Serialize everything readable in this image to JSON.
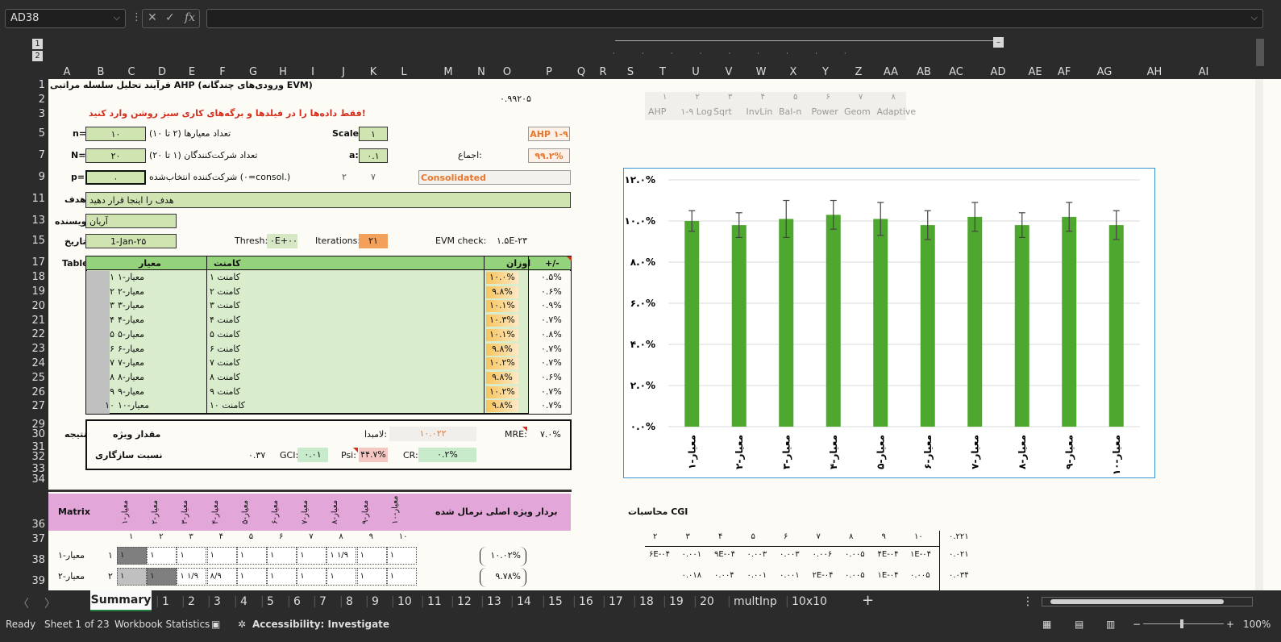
{
  "namebox": "AD38",
  "formula_bar": {
    "value": ""
  },
  "col_headers": [
    "A",
    "B",
    "C",
    "D",
    "E",
    "F",
    "G",
    "H",
    "I",
    "J",
    "K",
    "L",
    "M",
    "N",
    "O",
    "P",
    "Q",
    "R",
    "S",
    "T",
    "U",
    "V",
    "W",
    "X",
    "Y",
    "Z",
    "AA",
    "AB",
    "AC",
    "AD",
    "AE",
    "AF",
    "AG",
    "AH",
    "AI"
  ],
  "row_headers": [
    "1",
    "2",
    "3",
    "5",
    "7",
    "9",
    "11",
    "13",
    "15",
    "17",
    "18",
    "19",
    "20",
    "21",
    "22",
    "23",
    "24",
    "25",
    "26",
    "27",
    "29",
    "30",
    "31",
    "32",
    "33",
    "34",
    "36",
    "37",
    "38",
    "39"
  ],
  "outline_levels": [
    "1",
    "2"
  ],
  "sheet": {
    "title": "فرآیند تحلیل سلسله مراتبی AHP (ورودی‌های چندگانه EVM)",
    "top_value": "۰.۹۹۲۰۵",
    "instruction": "فقط داده‌ها را در فیلدها و برگه‌های کاری سبز روشن وارد کنید!",
    "n_label": "n=",
    "n_value": "۱۰",
    "n_desc": "تعداد معیارها (۲ تا ۱۰)",
    "scale_label": "Scale:",
    "scale_value": "۱",
    "scale_name": "AHP ۱-۹",
    "N_label": "N=",
    "N_value": "۲۰",
    "N_desc": "تعداد شرکت‌کنندگان (۱ تا ۲۰)",
    "a_label": "a:",
    "a_value": "۰.۱",
    "consensus_label": "اجماع:",
    "consensus_value": "۹۹.۲%",
    "p_label": "p=",
    "p_value": "۰",
    "p_desc": "شرکت‌کننده انتخاب‌شده (۰=consol.)",
    "p_num1": "۲",
    "p_num2": "۷",
    "consolidated": "Consolidated",
    "goal_label": "هدف",
    "goal_value": "هدف را اینجا قرار دهید",
    "author_label": "نویسنده",
    "author_value": "آریان",
    "date_label": "تاریخ",
    "date_value": "1-Jan-۲۵",
    "thresh_label": "Thresh:",
    "thresh_value": "۰E+۰۰",
    "iter_label": "Iterations:",
    "iter_value": "۲۱",
    "evm_label": "EVM check:",
    "evm_value": "۱.۵E-۲۳",
    "table_label": "Table",
    "col_criteria": "معیار",
    "col_comment": "کامنت",
    "col_weights": "اوزان",
    "col_pm": "+/-",
    "rows": [
      {
        "n": "۱",
        "c": "معیار-۱",
        "k": "کامنت ۱",
        "w": "۱۰.۰%",
        "p": "۰.۵%"
      },
      {
        "n": "۲",
        "c": "معیار-۲",
        "k": "کامنت ۲",
        "w": "۹.۸%",
        "p": "۰.۶%"
      },
      {
        "n": "۳",
        "c": "معیار-۳",
        "k": "کامنت ۳",
        "w": "۱۰.۱%",
        "p": "۰.۹%"
      },
      {
        "n": "۴",
        "c": "معیار-۴",
        "k": "کامنت ۴",
        "w": "۱۰.۳%",
        "p": "۰.۷%"
      },
      {
        "n": "۵",
        "c": "معیار-۵",
        "k": "کامنت ۵",
        "w": "۱۰.۱%",
        "p": "۰.۸%"
      },
      {
        "n": "۶",
        "c": "معیار-۶",
        "k": "کامنت ۶",
        "w": "۹.۸%",
        "p": "۰.۷%"
      },
      {
        "n": "۷",
        "c": "معیار-۷",
        "k": "کامنت ۷",
        "w": "۱۰.۲%",
        "p": "۰.۷%"
      },
      {
        "n": "۸",
        "c": "معیار-۸",
        "k": "کامنت ۸",
        "w": "۹.۸%",
        "p": "۰.۶%"
      },
      {
        "n": "۹",
        "c": "معیار-۹",
        "k": "کامنت ۹",
        "w": "۱۰.۲%",
        "p": "۰.۷%"
      },
      {
        "n": "۱۰",
        "c": "معیار-۱۰",
        "k": "کامنت ۱۰",
        "w": "۹.۸%",
        "p": "۰.۷%"
      }
    ],
    "result_label": "نتیجه",
    "eigen_label": "مقدار ویژه",
    "lambda_label": "لامبدا:",
    "lambda_value": "۱۰.۰۲۲",
    "mre_label": "MRE:",
    "mre_value": "۷.۰%",
    "consist_label": "نسبت سازگاری",
    "gci_pre": "۰.۳۷",
    "gci_label": "GCI:",
    "gci_value": "۰.۰۱",
    "psi_label": "Psi:",
    "psi_value": "۴۴.۷%",
    "cr_label": "CR:",
    "cr_value": "۰.۲%",
    "matrix_label": "Matrix",
    "evec_label": "بردار ویژه اصلی نرمال شده",
    "matrix_headers": [
      "معیار-۱",
      "معیار-۲",
      "معیار-۳",
      "معیار-۴",
      "معیار-۵",
      "معیار-۶",
      "معیار-۷",
      "معیار-۸",
      "معیار-۹",
      "معیار-۱۰"
    ],
    "matrix_nums": [
      "۱",
      "۲",
      "۳",
      "۴",
      "۵",
      "۶",
      "۷",
      "۸",
      "۹",
      "۱۰"
    ],
    "matrix_rows": [
      {
        "label": "معیار-۱",
        "n": "۱",
        "cells": [
          "۱",
          "۱",
          "۱",
          "۱",
          "۱",
          "۱",
          "۱",
          "۱ ۱/۹",
          "۱",
          "۱"
        ],
        "ev": "۱۰.۰۲%"
      },
      {
        "label": "معیار-۲",
        "n": "۲",
        "cells": [
          "۱",
          "۱",
          "۱ ۱/۹",
          "۸/۹",
          "۱",
          "۱",
          "۱",
          "۱",
          "۱",
          "۱"
        ],
        "ev": "۹.۷۸%"
      }
    ],
    "scale_options": {
      "nums": [
        "۱",
        "۲",
        "۳",
        "۴",
        "۵",
        "۶",
        "۷",
        "۸"
      ],
      "names": [
        "AHP",
        "۱-۹ Log",
        "Sqrt",
        "InvLin",
        "Bal-n",
        "Power",
        "Geom",
        "Adaptive"
      ]
    },
    "cgi_label": "محاسبات CGI",
    "cgi_header": [
      "۲",
      "۳",
      "۴",
      "۵",
      "۶",
      "۷",
      "۸",
      "۹",
      "۱۰"
    ],
    "cgi_header_r": "۰.۲۲۱",
    "cgi_row1": [
      "۶E-۰۴",
      "۰.۰۰۱",
      "۹E-۰۴",
      "۰.۰۰۳",
      "۰.۰۰۳",
      "۰.۰۰۶",
      "۰.۰۰۵",
      "۴E-۰۴",
      "۱E-۰۴"
    ],
    "cgi_row1_r": "۰.۰۲۱",
    "cgi_row2": [
      "",
      "۰.۰۱۸",
      "۰.۰۰۴",
      "۰.۰۰۱",
      "۰.۰۰۱",
      "۲E-۰۴",
      "۰.۰۰۵",
      "۱E-۰۴",
      "۰.۰۰۵"
    ],
    "cgi_row2_r": "۰.۰۳۴"
  },
  "chart_data": {
    "type": "bar",
    "categories": [
      "معیار-۱",
      "معیار-۲",
      "معیار-۳",
      "معیار-۴",
      "معیار-۵",
      "معیار-۶",
      "معیار-۷",
      "معیار-۸",
      "معیار-۹",
      "معیار-۱۰"
    ],
    "values": [
      10.0,
      9.8,
      10.1,
      10.3,
      10.1,
      9.8,
      10.2,
      9.8,
      10.2,
      9.8
    ],
    "errors": [
      0.5,
      0.6,
      0.9,
      0.7,
      0.8,
      0.7,
      0.7,
      0.6,
      0.7,
      0.7
    ],
    "ylim": [
      0,
      12
    ],
    "yticks": [
      "۰.۰%",
      "۲.۰%",
      "۴.۰%",
      "۶.۰%",
      "۸.۰%",
      "۱۰.۰%",
      "۱۲.۰%"
    ],
    "bar_color": "#4ea72e",
    "grid": true
  },
  "tabs": [
    "Summary",
    "1",
    "2",
    "3",
    "4",
    "5",
    "6",
    "7",
    "8",
    "9",
    "10",
    "11",
    "12",
    "13",
    "14",
    "15",
    "16",
    "17",
    "18",
    "19",
    "20",
    "multInp",
    "10x10"
  ],
  "status": {
    "ready": "Ready",
    "sheet_info": "Sheet 1 of 23",
    "workbook_stats": "Workbook Statistics",
    "accessibility": "Accessibility: Investigate",
    "zoom": "100%"
  }
}
